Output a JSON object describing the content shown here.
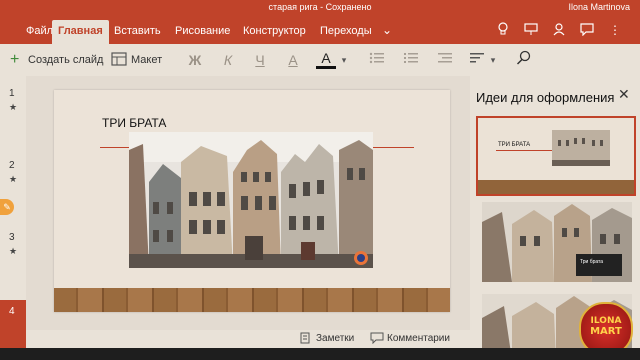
{
  "title_bar": {
    "document_title": "старая рига - Сохранено",
    "user_name": "Ilona Martinova"
  },
  "tabs": [
    "Файл",
    "Главная",
    "Вставить",
    "Рисование",
    "Конструктор",
    "Переходы"
  ],
  "toolbar": {
    "new_slide_label": "Создать слайд",
    "layout_label": "Макет",
    "bold_glyph": "Ж",
    "italic_glyph": "К",
    "underline_glyph": "Ч",
    "font_color_glyph": "А",
    "highlight_glyph": "А"
  },
  "slides": [
    {
      "number": "1",
      "mark": "★"
    },
    {
      "number": "2",
      "mark": "★"
    },
    {
      "number": "3",
      "mark": "★"
    },
    {
      "number": "4",
      "mark": ""
    }
  ],
  "slide": {
    "title": "ТРИ БРАТА"
  },
  "status": {
    "notes_label": "Заметки",
    "comments_label": "Комментарии"
  },
  "design_panel": {
    "title": "Идеи для оформления",
    "thumb1_title": "ТРИ БРАТА",
    "thumb2_title": "Три брата"
  },
  "watermark": {
    "line1": "ILONA",
    "line2": "MART"
  },
  "colors": {
    "accent": "#c0432a",
    "background": "#e9e2d8"
  }
}
